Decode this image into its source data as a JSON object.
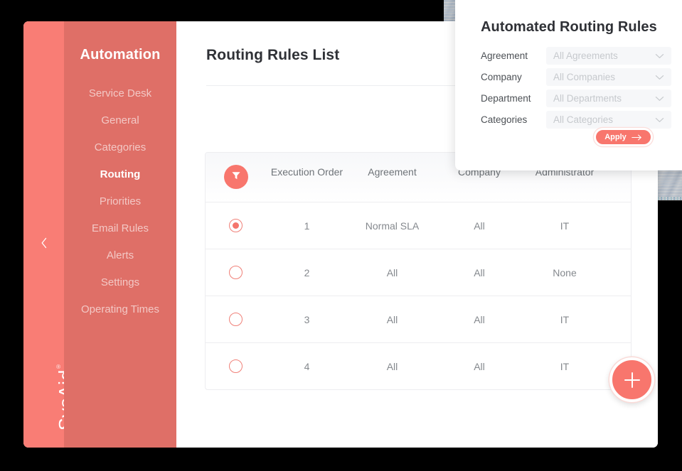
{
  "sidebar": {
    "title": "Automation",
    "collapse_icon": "chevron-left-icon",
    "brand": "SysAid",
    "brand_mark": "®",
    "items": [
      {
        "label": "Service Desk",
        "active": false
      },
      {
        "label": "General",
        "active": false
      },
      {
        "label": "Categories",
        "active": false
      },
      {
        "label": "Routing",
        "active": true
      },
      {
        "label": "Priorities",
        "active": false
      },
      {
        "label": "Email Rules",
        "active": false
      },
      {
        "label": "Alerts",
        "active": false
      },
      {
        "label": "Settings",
        "active": false
      },
      {
        "label": "Operating Times",
        "active": false
      }
    ]
  },
  "content": {
    "page_title": "Routing Rules List",
    "add_button_icon": "plus-icon"
  },
  "table": {
    "filter_icon": "filter-funnel-icon",
    "columns": [
      "Execution Order",
      "Agreement",
      "Company",
      "Administrator"
    ],
    "rows": [
      {
        "selected": true,
        "order": "1",
        "agreement": "Normal SLA",
        "company": "All",
        "administrator": "IT"
      },
      {
        "selected": false,
        "order": "2",
        "agreement": "All",
        "company": "All",
        "administrator": "None"
      },
      {
        "selected": false,
        "order": "3",
        "agreement": "All",
        "company": "All",
        "administrator": "IT"
      },
      {
        "selected": false,
        "order": "4",
        "agreement": "All",
        "company": "All",
        "administrator": "IT"
      }
    ]
  },
  "panel": {
    "title": "Automated Routing Rules",
    "fields": [
      {
        "label": "Agreement",
        "value": "All Agreements",
        "icon": "chevron-down-icon"
      },
      {
        "label": "Company",
        "value": "All Companies",
        "icon": "chevron-down-icon"
      },
      {
        "label": "Department",
        "value": "All Departments",
        "icon": "chevron-down-icon"
      },
      {
        "label": "Categories",
        "value": "All Categories",
        "icon": "chevron-down-icon"
      }
    ],
    "apply_label": "Apply",
    "apply_icon": "arrow-right-icon"
  },
  "colors": {
    "accent": "#f8766d",
    "sidebar_rail": "#f97d75",
    "sidebar_main": "#df6f67",
    "page_background": "#000000",
    "card_background": "#ffffff",
    "text_primary": "#2f3136",
    "text_muted": "#85898e"
  }
}
